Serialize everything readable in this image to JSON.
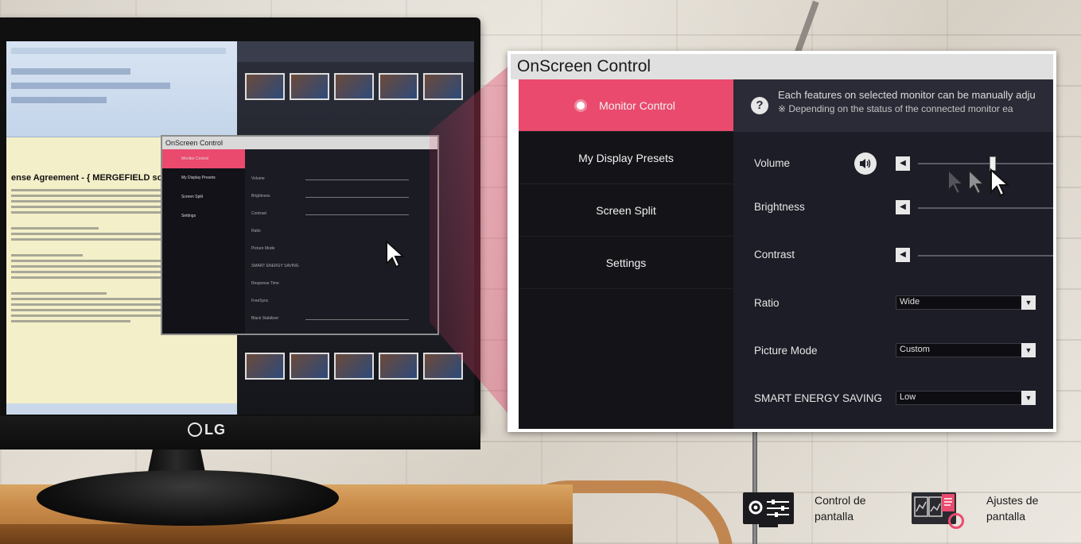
{
  "brand": {
    "logo": "LG"
  },
  "osc": {
    "title": "OnScreen Control",
    "menu": [
      {
        "label": "Monitor Control",
        "active": true
      },
      {
        "label": "My Display Presets",
        "active": false
      },
      {
        "label": "Screen Split",
        "active": false
      },
      {
        "label": "Settings",
        "active": false
      }
    ],
    "info_line1": "Each features on selected monitor can be manually adju",
    "info_line2": "※ Depending on the status of the connected monitor ea",
    "settings": {
      "volume_label": "Volume",
      "brightness_label": "Brightness",
      "contrast_label": "Contrast",
      "ratio_label": "Ratio",
      "ratio_value": "Wide",
      "picture_mode_label": "Picture Mode",
      "picture_mode_value": "Custom",
      "energy_label": "SMART ENERGY SAVING",
      "energy_value": "Low"
    },
    "volume_level": 0.55
  },
  "mini_osc": {
    "title": "OnScreen Control",
    "menu": [
      "Monitor Control",
      "My Display Presets",
      "Screen Split",
      "Settings"
    ],
    "rows": [
      "Volume",
      "Brightness",
      "Contrast",
      "Ratio",
      "Picture Mode",
      "SMART ENERGY SAVING",
      "Response Time",
      "FreeSync",
      "Black Stabilizer"
    ]
  },
  "doc": {
    "title": "ense Agreement - { MERGEFIELD software }"
  },
  "features": [
    {
      "line1": "Control de",
      "line2": "pantalla",
      "icon": "monitor-control-icon"
    },
    {
      "line1": "Ajustes de",
      "line2": "pantalla",
      "icon": "screen-settings-icon"
    }
  ],
  "colors": {
    "accent": "#ea4a6e",
    "panel_bg": "#1d1d27",
    "menu_bg": "#141418"
  }
}
